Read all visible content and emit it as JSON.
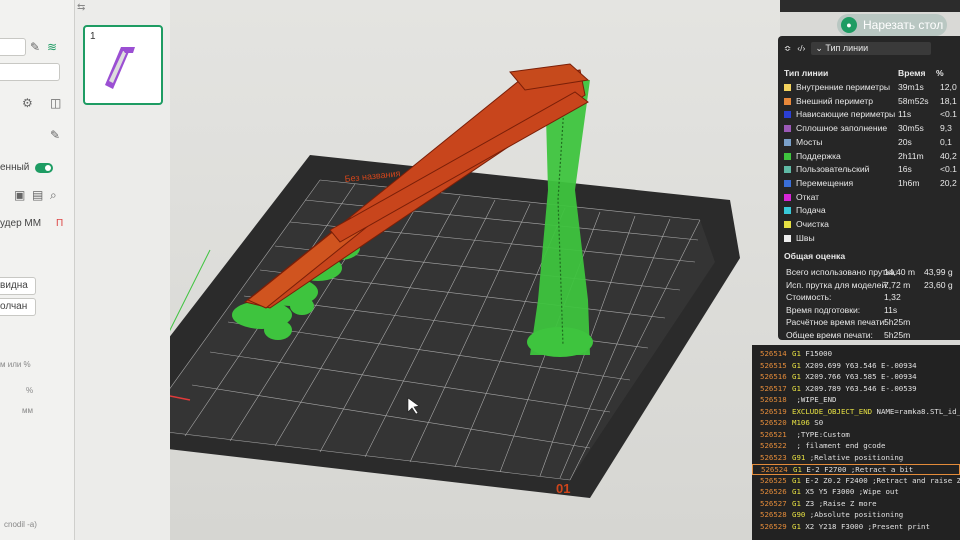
{
  "slice_button": {
    "label": "Нарезать стол"
  },
  "plate": {
    "number": "1"
  },
  "viewport": {
    "bed_label": "Без названия",
    "plate_id": "01"
  },
  "sidebar": {
    "toggle_label": "енный",
    "extruder_label": "удер ММ",
    "fragment_visible": "видна",
    "fragment_default": "олчан",
    "fragment_mm_or_pct": "м или %",
    "fragment_pct": "%",
    "fragment_mm": "мм",
    "footer": "cnodil -a)"
  },
  "legend": {
    "select_label": "Тип линии",
    "columns": {
      "type": "Тип линии",
      "time": "Время",
      "percent": "%"
    },
    "rows": [
      {
        "label": "Внутренние периметры",
        "time": "39m1s",
        "percent": "12,0",
        "color": "#f4d35e"
      },
      {
        "label": "Внешний периметр",
        "time": "58m52s",
        "percent": "18,1",
        "color": "#e8883a"
      },
      {
        "label": "Нависающие периметры",
        "time": "11s",
        "percent": "<0.1",
        "color": "#2b3fd4"
      },
      {
        "label": "Сплошное заполнение",
        "time": "30m5s",
        "percent": "9,3",
        "color": "#9b59b6"
      },
      {
        "label": "Мосты",
        "time": "20s",
        "percent": "0,1",
        "color": "#7aa0c9"
      },
      {
        "label": "Поддержка",
        "time": "2h11m",
        "percent": "40,2",
        "color": "#3ec43e"
      },
      {
        "label": "Пользовательский",
        "time": "16s",
        "percent": "<0.1",
        "color": "#5fb9a4"
      },
      {
        "label": "Перемещения",
        "time": "1h6m",
        "percent": "20,2",
        "color": "#3a6fd8"
      },
      {
        "label": "Откат",
        "time": "",
        "percent": "",
        "color": "#d726d7"
      },
      {
        "label": "Подача",
        "time": "",
        "percent": "",
        "color": "#39c9d9"
      },
      {
        "label": "Очистка",
        "time": "",
        "percent": "",
        "color": "#e6e043"
      },
      {
        "label": "Швы",
        "time": "",
        "percent": "",
        "color": "#eeeeee"
      }
    ],
    "summary_title": "Общая оценка",
    "summary": [
      {
        "label": "Всего использовано прутка:",
        "v1": "14,40 m",
        "v2": "43,99 g"
      },
      {
        "label": "Исп. прутка для моделей:",
        "v1": "7,72 m",
        "v2": "23,60 g"
      },
      {
        "label": "Стоимость:",
        "v1": "1,32",
        "v2": ""
      },
      {
        "label": "Время подготовки:",
        "v1": "11s",
        "v2": ""
      },
      {
        "label": "Расчётное время печати:",
        "v1": "5h25m",
        "v2": ""
      },
      {
        "label": "Общее время печати:",
        "v1": "5h25m",
        "v2": ""
      }
    ]
  },
  "gcode": {
    "lines": [
      {
        "num": "526514",
        "cmd": "G1",
        "rest": " F15000"
      },
      {
        "num": "526515",
        "cmd": "G1",
        "rest": " X209.699 Y63.546 E-.00934"
      },
      {
        "num": "526516",
        "cmd": "G1",
        "rest": " X209.766 Y63.585 E-.00934"
      },
      {
        "num": "526517",
        "cmd": "G1",
        "rest": " X209.789 Y63.546 E-.00539"
      },
      {
        "num": "526518",
        "cmd": "",
        "rest": " ;WIPE_END"
      },
      {
        "num": "526519",
        "cmd": "EXCLUDE_OBJECT_END",
        "rest": " NAME=ramka8.STL_id_"
      },
      {
        "num": "526520",
        "cmd": "M106",
        "rest": " S0"
      },
      {
        "num": "526521",
        "cmd": "",
        "rest": " ;TYPE:Custom"
      },
      {
        "num": "526522",
        "cmd": "",
        "rest": " ; filament end gcode"
      },
      {
        "num": "526523",
        "cmd": "G91",
        "rest": " ;Relative positioning"
      },
      {
        "num": "526524",
        "cmd": "G1",
        "rest": " E-2 F2700 ;Retract a bit"
      },
      {
        "num": "526525",
        "cmd": "G1",
        "rest": " E-2 Z0.2 F2400 ;Retract and raise Z"
      },
      {
        "num": "526526",
        "cmd": "G1",
        "rest": " X5 Y5 F3000 ;Wipe out"
      },
      {
        "num": "526527",
        "cmd": "G1",
        "rest": " Z3 ;Raise Z more"
      },
      {
        "num": "526528",
        "cmd": "G90",
        "rest": " ;Absolute positioning"
      },
      {
        "num": "526529",
        "cmd": "G1",
        "rest": " X2 Y218 F3000 ;Present print"
      }
    ],
    "active_index": 10
  }
}
